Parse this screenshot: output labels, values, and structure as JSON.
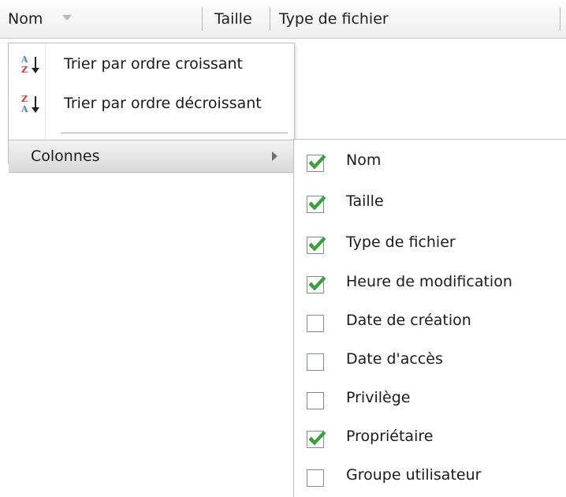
{
  "header": {
    "columns": [
      {
        "label": "Nom"
      },
      {
        "label": "Taille"
      },
      {
        "label": "Type de fichier"
      }
    ]
  },
  "context_menu": {
    "items": [
      {
        "label": "Trier par ordre croissant",
        "icon": "sort-ascending-icon"
      },
      {
        "label": "Trier par ordre décroissant",
        "icon": "sort-descending-icon"
      },
      {
        "label": "Colonnes",
        "icon": "submenu-arrow-icon"
      }
    ]
  },
  "columns_submenu": {
    "items": [
      {
        "label": "Nom",
        "checked": true
      },
      {
        "label": "Taille",
        "checked": true
      },
      {
        "label": "Type de fichier",
        "checked": true
      },
      {
        "label": "Heure de modification",
        "checked": true
      },
      {
        "label": "Date de création",
        "checked": false
      },
      {
        "label": "Date d'accès",
        "checked": false
      },
      {
        "label": "Privilège",
        "checked": false
      },
      {
        "label": "Propriétaire",
        "checked": true
      },
      {
        "label": "Groupe utilisateur",
        "checked": false
      }
    ]
  },
  "colors": {
    "check_green": "#3aa53a",
    "letter_a": "#4a7fc4",
    "letter_z": "#c0392b"
  }
}
